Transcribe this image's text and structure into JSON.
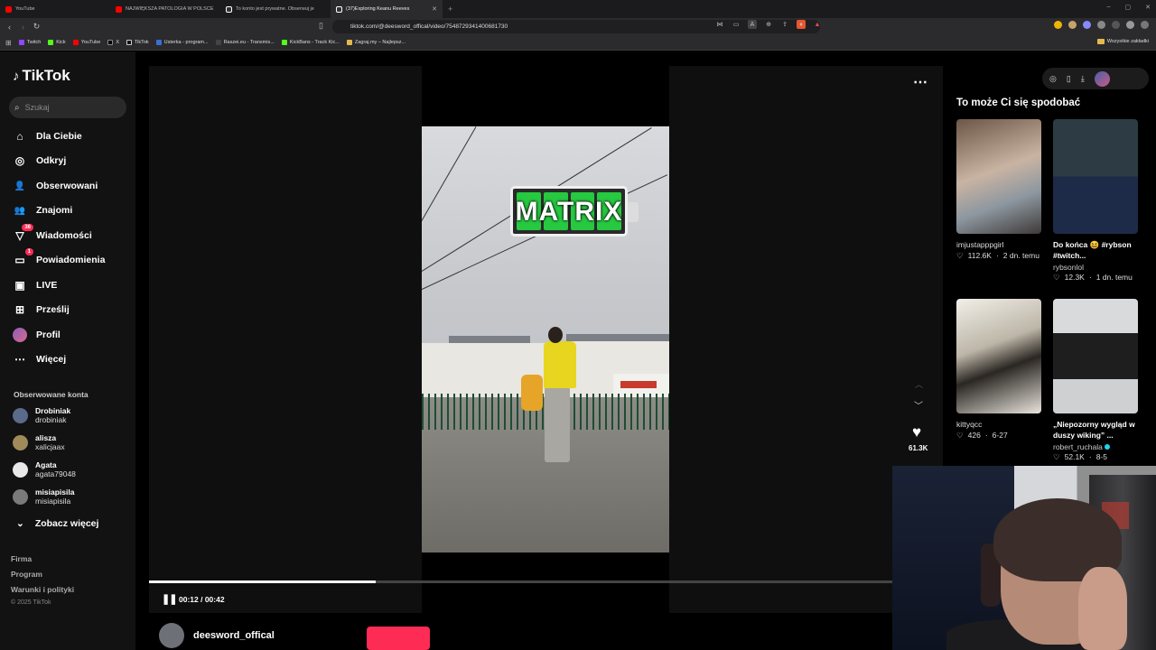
{
  "browser": {
    "tabs": [
      {
        "title": "YouTube",
        "color": "#ff0000"
      },
      {
        "title": "NAJWIĘKSZA PATOLOGIA W POLSCE",
        "color": "#ff0000"
      },
      {
        "title": "To konto jest prywatne. Obserwuj je",
        "color": "#ffffff"
      },
      {
        "title": "(37)Exploring Keanu Reeves",
        "color": "#ffffff"
      }
    ],
    "new_tab": "+",
    "url": "tiktok.com/@deesword_offical/video/7548729341400681730",
    "bookmarks": [
      "Twitch",
      "Kick",
      "YouTube",
      "X",
      "TikTok",
      "Usterka - program...",
      "Raszei.eu - Transmis...",
      "KickBans - Track Kic...",
      "Zagraj.my – Najlepsz..."
    ],
    "bookmark_folder": "Wszystkie zakładki"
  },
  "sidebar": {
    "logo": "TikTok",
    "search_placeholder": "Szukaj",
    "nav": [
      {
        "label": "Dla Ciebie",
        "icon": "home-icon",
        "glyph": "⌂"
      },
      {
        "label": "Odkryj",
        "icon": "compass-icon",
        "glyph": "◎"
      },
      {
        "label": "Obserwowani",
        "icon": "following-icon",
        "glyph": "👤"
      },
      {
        "label": "Znajomi",
        "icon": "friends-icon",
        "glyph": "👥"
      },
      {
        "label": "Wiadomości",
        "icon": "messages-icon",
        "glyph": "▽",
        "badge": "36"
      },
      {
        "label": "Powiadomienia",
        "icon": "notifications-icon",
        "glyph": "▭",
        "badge": "1"
      },
      {
        "label": "LIVE",
        "icon": "live-icon",
        "glyph": "▣"
      },
      {
        "label": "Prześlij",
        "icon": "upload-icon",
        "glyph": "⊞"
      },
      {
        "label": "Profil",
        "icon": "profile-icon",
        "glyph": ""
      },
      {
        "label": "Więcej",
        "icon": "more-icon",
        "glyph": "⋯"
      }
    ],
    "followed_title": "Obserwowane konta",
    "followed": [
      {
        "name": "Drobiniak",
        "handle": "drobiniak",
        "color": "#5a6a8a"
      },
      {
        "name": "alisza",
        "handle": "xalicjaax",
        "color": "#a08a5a"
      },
      {
        "name": "Agata",
        "handle": "agata79048",
        "color": "#e8e8e8"
      },
      {
        "name": "misiapisila",
        "handle": "misiapisila",
        "color": "#7a7a7a"
      }
    ],
    "see_more": "Zobacz więcej",
    "footer": [
      "Firma",
      "Program",
      "Warunki i polityki"
    ],
    "copyright": "© 2025 TikTok"
  },
  "player": {
    "overlay_text": "MATRIX",
    "time": "00:12 / 00:42",
    "progress": 0.2857,
    "likes": "61.3K",
    "author": "deesword_offical"
  },
  "recommendations": {
    "title": "To może Ci się spodobać",
    "items": [
      {
        "caption": "imjustapppgirl",
        "caption_style": "plain",
        "likes": "112.6K",
        "date": "2 dn. temu",
        "user": ""
      },
      {
        "caption": "Do końca 😆 #rybson #twitch...",
        "caption_style": "bold",
        "likes": "12.3K",
        "date": "1 dn. temu",
        "user": "rybsonlol"
      },
      {
        "caption": "kittyqcc",
        "caption_style": "plain",
        "likes": "426",
        "date": "6-27",
        "user": ""
      },
      {
        "caption": "„Niepozorny wygląd w duszy wiking” ...",
        "caption_style": "bold",
        "likes": "52.1K",
        "date": "8-5",
        "user": "robert_ruchala"
      }
    ]
  }
}
